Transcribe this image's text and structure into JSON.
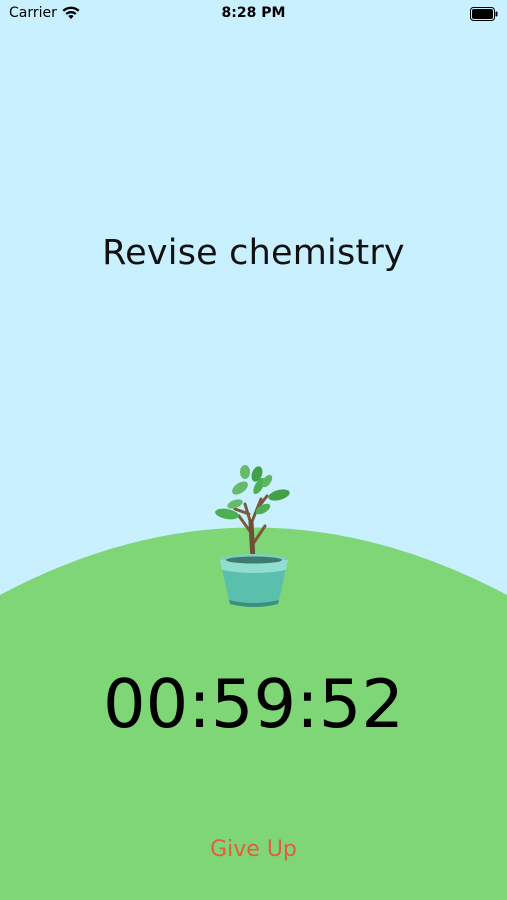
{
  "status_bar": {
    "carrier": "Carrier",
    "time": "8:28 PM",
    "wifi_icon": "wifi-icon",
    "battery_icon": "battery-full-icon"
  },
  "session": {
    "task_title": "Revise chemistry",
    "timer": "00:59:52",
    "give_up_label": "Give Up"
  },
  "colors": {
    "sky": "#c8f0fe",
    "grass": "#7fd677",
    "give_up": "#e65c3d"
  }
}
